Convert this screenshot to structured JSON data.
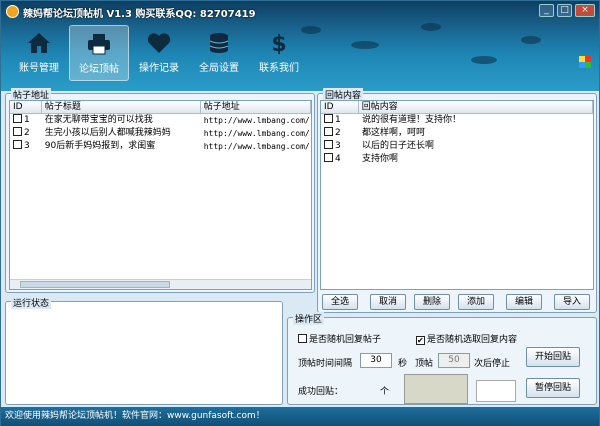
{
  "title": "辣妈帮论坛顶帖机 V1.3 购买联系QQ: 82707419",
  "window_buttons": [
    "_",
    "□",
    "×"
  ],
  "toolbar": [
    {
      "label": "账号管理",
      "icon": "home-icon"
    },
    {
      "label": "论坛顶帖",
      "icon": "printer-icon",
      "active": true
    },
    {
      "label": "操作记录",
      "icon": "heart-icon"
    },
    {
      "label": "全局设置",
      "icon": "database-icon"
    },
    {
      "label": "联系我们",
      "icon": "dollar-icon"
    }
  ],
  "posts": {
    "group_label": "帖子地址",
    "headers": [
      "ID",
      "帖子标题",
      "帖子地址"
    ],
    "rows": [
      {
        "id": "1",
        "title": "在家无聊带宝宝的可以找我",
        "url": "http://www.lmbang.com/"
      },
      {
        "id": "2",
        "title": "生完小孩以后别人都喊我辣妈妈",
        "url": "http://www.lmbang.com/"
      },
      {
        "id": "3",
        "title": "90后新手妈妈报到，求闺蜜",
        "url": "http://www.lmbang.com/"
      }
    ]
  },
  "replies": {
    "group_label": "回帖内容",
    "headers": [
      "ID",
      "回帖内容"
    ],
    "rows": [
      {
        "id": "1",
        "text": "说的很有道理！支持你！"
      },
      {
        "id": "2",
        "text": "都这样啊，呵呵"
      },
      {
        "id": "3",
        "text": "以后的日子还长啊"
      },
      {
        "id": "4",
        "text": "支持你啊"
      }
    ]
  },
  "reply_buttons": [
    "全选",
    "取消",
    "删除",
    "添加",
    "编辑",
    "导入"
  ],
  "status_group": {
    "label": "运行状态"
  },
  "ops": {
    "label": "操作区",
    "random_post": {
      "label": "是否随机回复帖子",
      "checked": false
    },
    "random_content": {
      "label": "是否随机选取回复内容",
      "checked": true
    },
    "interval_label": "顶帖时间间隔",
    "interval_value": "30",
    "interval_unit": "秒",
    "stop_label_a": "顶帖",
    "stop_value": "50",
    "stop_label_b": "次后停止",
    "success_label": "成功回贴：",
    "success_unit": "个",
    "start_button": "开始回贴",
    "pause_button": "暂停回贴"
  },
  "statusbar": "欢迎使用辣妈帮论坛顶帖机！软件官网：www.gunfasoft.com！"
}
